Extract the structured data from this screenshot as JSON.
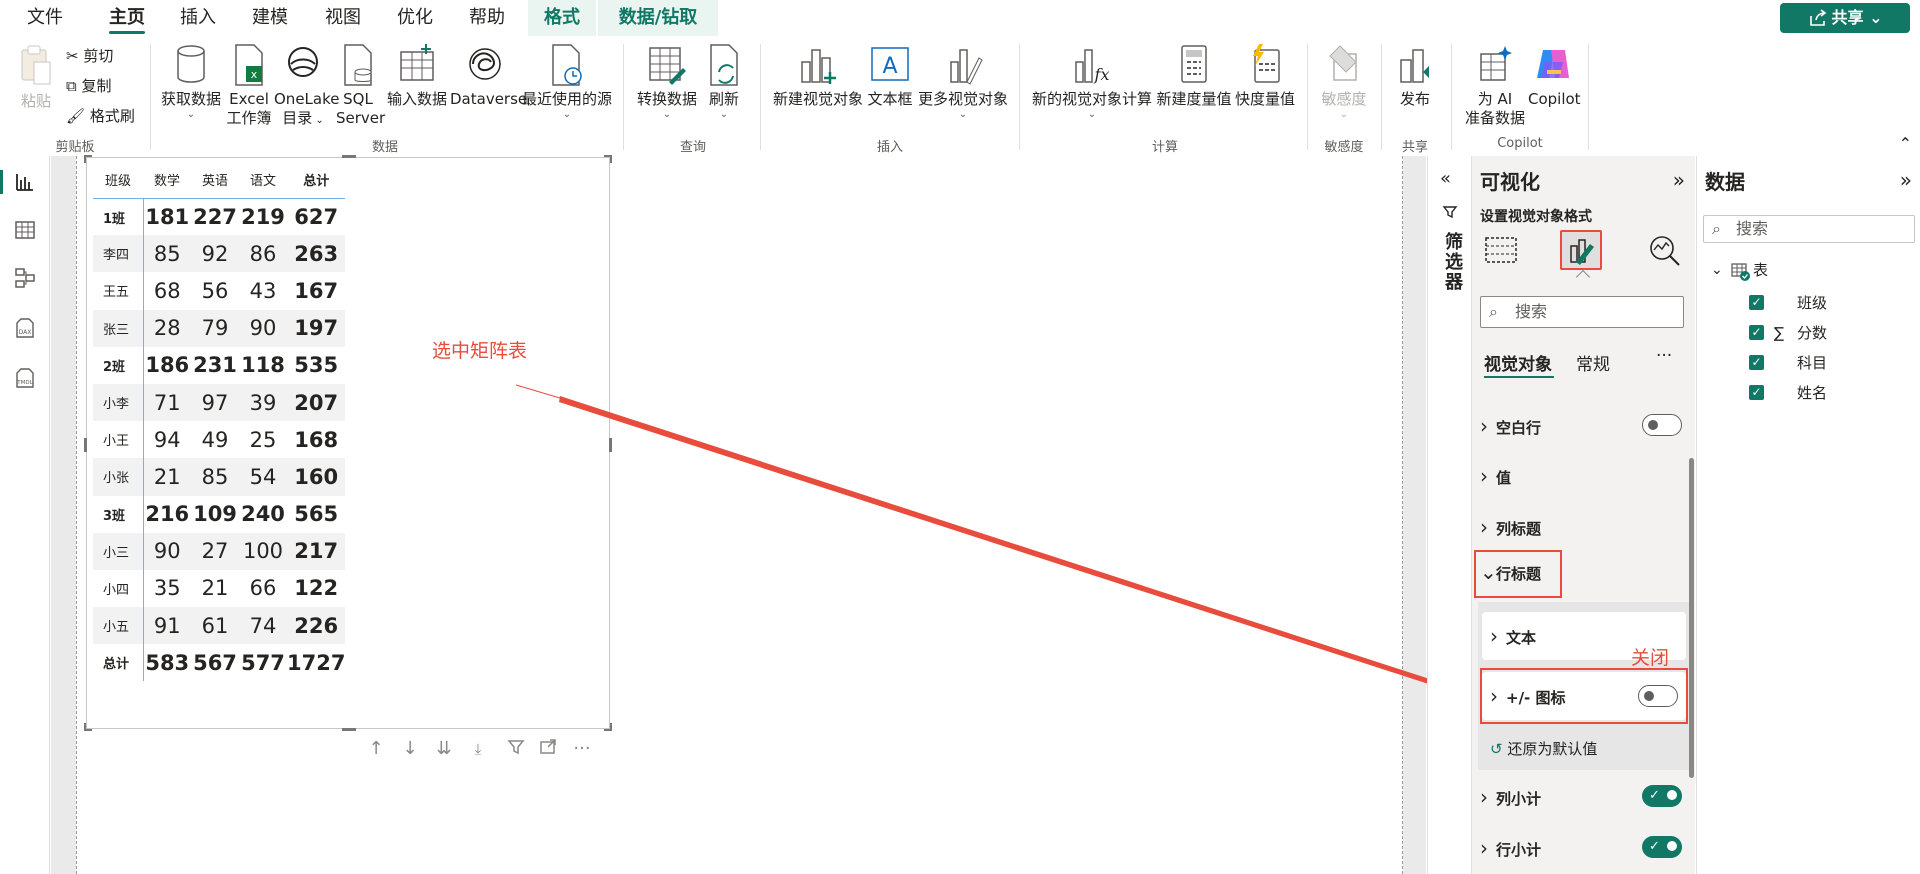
{
  "menu": {
    "tabs": [
      "文件",
      "主页",
      "插入",
      "建模",
      "视图",
      "优化",
      "帮助",
      "格式",
      "数据/钻取"
    ],
    "share_label": "共享"
  },
  "ribbon": {
    "clipboard": {
      "paste": "粘贴",
      "cut": "剪切",
      "copy": "复制",
      "format_painter": "格式刷",
      "group": "剪贴板"
    },
    "data": {
      "get_data": "获取数据",
      "excel_1": "Excel",
      "excel_2": "工作簿",
      "onelake_1": "OneLake",
      "onelake_2": "目录",
      "sql_1": "SQL",
      "sql_2": "Server",
      "enter_data": "输入数据",
      "dataverse": "Dataverse",
      "recent": "最近使用的源",
      "group": "数据"
    },
    "query": {
      "transform": "转换数据",
      "refresh": "刷新",
      "group": "查询"
    },
    "insert": {
      "new_visual": "新建视觉对象",
      "text_box": "文本框",
      "more_visuals": "更多视觉对象",
      "group": "插入"
    },
    "calc": {
      "new_visual_calc": "新的视觉对象计算",
      "new_measure": "新建度量值",
      "quick_measure": "快度量值",
      "group": "计算"
    },
    "sensitivity": {
      "label": "敏感度",
      "group": "敏感度"
    },
    "share": {
      "publish": "发布",
      "group": "共享"
    },
    "copilot": {
      "ai_1": "为 AI",
      "ai_2": "准备数据",
      "copilot": "Copilot",
      "group": "Copilot"
    }
  },
  "matrix": {
    "headers": [
      "班级",
      "数学",
      "英语",
      "语文",
      "总计"
    ],
    "rows": [
      {
        "label": "1班",
        "v": [
          "181",
          "227",
          "219",
          "627"
        ],
        "bold": true
      },
      {
        "label": "李四",
        "v": [
          "85",
          "92",
          "86",
          "263"
        ],
        "bold": false
      },
      {
        "label": "王五",
        "v": [
          "68",
          "56",
          "43",
          "167"
        ],
        "bold": false
      },
      {
        "label": "张三",
        "v": [
          "28",
          "79",
          "90",
          "197"
        ],
        "bold": false
      },
      {
        "label": "2班",
        "v": [
          "186",
          "231",
          "118",
          "535"
        ],
        "bold": true
      },
      {
        "label": "小李",
        "v": [
          "71",
          "97",
          "39",
          "207"
        ],
        "bold": false
      },
      {
        "label": "小王",
        "v": [
          "94",
          "49",
          "25",
          "168"
        ],
        "bold": false
      },
      {
        "label": "小张",
        "v": [
          "21",
          "85",
          "54",
          "160"
        ],
        "bold": false
      },
      {
        "label": "3班",
        "v": [
          "216",
          "109",
          "240",
          "565"
        ],
        "bold": true
      },
      {
        "label": "小三",
        "v": [
          "90",
          "27",
          "100",
          "217"
        ],
        "bold": false
      },
      {
        "label": "小四",
        "v": [
          "35",
          "21",
          "66",
          "122"
        ],
        "bold": false
      },
      {
        "label": "小五",
        "v": [
          "91",
          "61",
          "74",
          "226"
        ],
        "bold": false
      },
      {
        "label": "总计",
        "v": [
          "583",
          "567",
          "577",
          "1727"
        ],
        "bold": true
      }
    ]
  },
  "annotations": {
    "select_matrix": "选中矩阵表",
    "close": "关闭"
  },
  "filter": {
    "label": "筛选器"
  },
  "viz": {
    "title": "可视化",
    "subtitle": "设置视觉对象格式",
    "search_placeholder": "搜索",
    "tab_visual": "视觉对象",
    "tab_general": "常规",
    "more": "···",
    "sections": {
      "blank_rows": "空白行",
      "values": "值",
      "column_headers": "列标题",
      "row_headers": "行标题",
      "text": "文本",
      "plus_minus": "+/- 图标",
      "reset": "还原为默认值",
      "column_subtotals": "列小计",
      "row_subtotals": "行小计"
    },
    "toggles": {
      "blank_rows": false,
      "plus_minus": false,
      "column_subtotals": true,
      "row_subtotals": true
    }
  },
  "data_pane": {
    "title": "数据",
    "search_placeholder": "搜索",
    "table_name": "表",
    "fields": [
      {
        "name": "班级",
        "checked": true,
        "sigma": false
      },
      {
        "name": "分数",
        "checked": true,
        "sigma": true
      },
      {
        "name": "科目",
        "checked": true,
        "sigma": false
      },
      {
        "name": "姓名",
        "checked": true,
        "sigma": false
      }
    ]
  },
  "colors": {
    "accent": "#117865",
    "annotation": "#e74c3c",
    "matrix_divider": "#74b3ea"
  }
}
